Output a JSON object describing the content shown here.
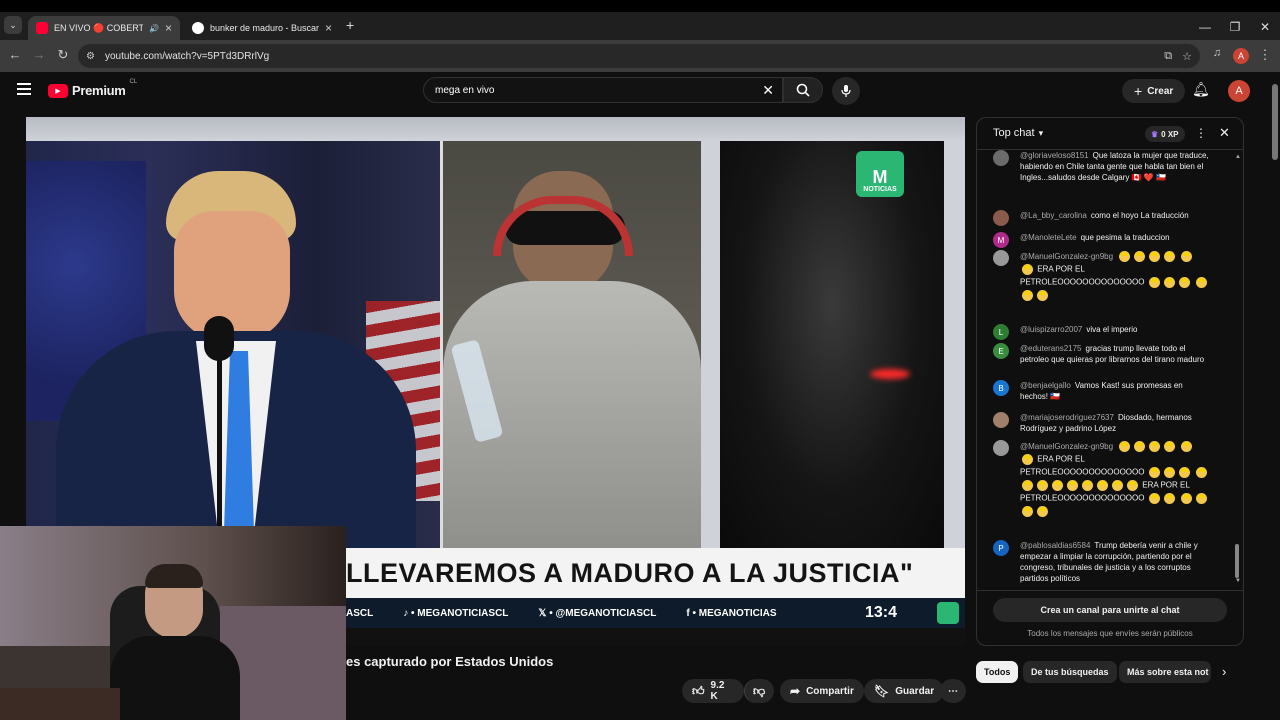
{
  "browser": {
    "tabs": [
      {
        "label": "EN VIVO 🔴 COBERTURA E",
        "active": true
      },
      {
        "label": "bunker de maduro - Buscar con",
        "active": false
      }
    ],
    "new_tab_label": "+",
    "url": "youtube.com/watch?v=5PTd3DRrlVg",
    "profile_initial": "A"
  },
  "masthead": {
    "brand": "Premium",
    "region": "CL",
    "search_value": "mega en vivo",
    "create_label": "Crear",
    "avatar_initial": "A"
  },
  "video": {
    "banner_text": "LLEVAREMOS A MADURO A LA JUSTICIA\"",
    "ticker": [
      "ASCL",
      "MEGANOTICIASCL",
      "@MEGANOTICIASCL",
      "MEGANOTICIAS"
    ],
    "time": "13:4",
    "channel_logo_text": "NOTICIAS",
    "title": "es capturado por Estados Unidos"
  },
  "actions": {
    "likes": "9.2 K",
    "share": "Compartir",
    "save": "Guardar"
  },
  "chat": {
    "header": "Top chat",
    "xp": "0 XP",
    "messages": [
      {
        "author": "@gloriaveloso8151",
        "text": "Que latoza la mujer que traduce, habiendo en Chile tanta gente que habla tan bien el Ingles...saludos desde Calgary 🇨🇦 ❤️ 🇨🇱",
        "avatar": "",
        "color": "#777"
      },
      {
        "author": "@La_bby_carolina",
        "text": "como el hoyo La traducción",
        "avatar": "",
        "color": "#8a5a4a"
      },
      {
        "author": "@ManoleteLete",
        "text": "que pesima la traduccion",
        "avatar": "M",
        "color": "#b02a8a"
      },
      {
        "author": "@ManuelGonzalez-gn9bg",
        "text": "ERA POR EL PETROLEOOOOOOOOOOOOOO",
        "avatar": "",
        "color": "#999"
      },
      {
        "author": "@luispizarro2007",
        "text": "viva el imperio",
        "avatar": "L",
        "color": "#2e7d32"
      },
      {
        "author": "@eduterans2175",
        "text": "gracias trump llevate todo el petroleo que quieras por librarnos del tirano maduro",
        "avatar": "E",
        "color": "#388e3c"
      },
      {
        "author": "@benjaelgallo",
        "text": "Vamos Kast! sus promesas en hechos! 🇨🇱",
        "avatar": "B",
        "color": "#1976d2"
      },
      {
        "author": "@mariajoserodriguez7637",
        "text": "Diosdado, hermanos Rodríguez y padrino López",
        "avatar": "",
        "color": "#a0806a"
      },
      {
        "author": "@ManuelGonzalez-gn9bg",
        "text": "ERA POR EL PETROLEOOOOOOOOOOOOOO",
        "extra": "ERA POR EL PETROLEOOOOOOOOOOOOOO",
        "avatar": "",
        "color": "#999"
      },
      {
        "author": "@pablosaldias6584",
        "text": "Trump debería venir a chile y empezar a limpiar la corrupción, partiendo por el congreso, tribunales de justicia y a los corruptos partidos políticos",
        "avatar": "P",
        "color": "#1565c0"
      }
    ],
    "join_button": "Crea un canal para unirte al chat",
    "footer_note": "Todos los mensajes que envíes serán públicos"
  },
  "chips": [
    "Todos",
    "De tus búsquedas",
    "Más sobre esta not"
  ],
  "colors": {
    "youtube_red": "#ff0033",
    "mega_green": "#2bb673"
  }
}
